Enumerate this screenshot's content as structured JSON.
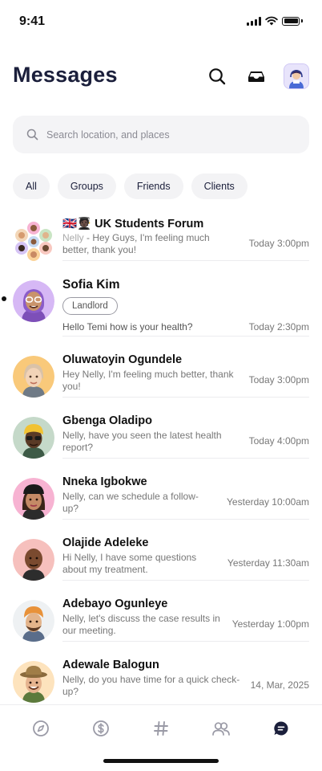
{
  "status_bar": {
    "time": "9:41"
  },
  "header": {
    "title": "Messages"
  },
  "search": {
    "placeholder": "Search location, and places"
  },
  "filters": [
    {
      "label": "All"
    },
    {
      "label": "Groups"
    },
    {
      "label": "Friends"
    },
    {
      "label": "Clients"
    }
  ],
  "conversations": [
    {
      "name": "🇬🇧🧑🏿‍🎓 UK Students Forum",
      "sender": "Nelly",
      "message": " - Hey Guys, I'm feeling much better, thank you!",
      "time": "Today 3:00pm",
      "avatar_bg": "#ffffff"
    },
    {
      "name": "Sofia Kim",
      "tag": "Landlord",
      "message": "Hello Temi how is your health?",
      "time": "Today 2:30pm",
      "unread": true,
      "avatar_bg": "#d6b8f5"
    },
    {
      "name": "Oluwatoyin Ogundele",
      "message": "Hey Nelly, I'm feeling much better, thank you!",
      "time": "Today 3:00pm",
      "avatar_bg": "#f9c97a"
    },
    {
      "name": "Gbenga Oladipo",
      "message": "Nelly, have you seen the latest health report?",
      "time": "Today 4:00pm",
      "avatar_bg": "#c5d9c9"
    },
    {
      "name": "Nneka Igbokwe",
      "message": "Nelly, can we schedule a follow-up?",
      "time": "Yesterday 10:00am",
      "avatar_bg": "#f7b3d2"
    },
    {
      "name": "Olajide Adeleke",
      "message": "Hi Nelly, I have some questions about my treatment.",
      "time": "Yesterday 11:30am",
      "avatar_bg": "#f6c0bd"
    },
    {
      "name": "Adebayo Ogunleye",
      "message": "Nelly, let's discuss the case results in our meeting.",
      "time": "Yesterday 1:00pm",
      "avatar_bg": "#eef1f3"
    },
    {
      "name": "Adewale Balogun",
      "message": "Nelly, do you have time for a quick check-up?",
      "time": "14, Mar, 2025",
      "avatar_bg": "#fde3bd"
    }
  ],
  "tab_bar": [
    {
      "icon": "compass-icon",
      "active": false
    },
    {
      "icon": "dollar-icon",
      "active": false
    },
    {
      "icon": "hashtag-icon",
      "active": false
    },
    {
      "icon": "people-icon",
      "active": false
    },
    {
      "icon": "chat-icon",
      "active": true
    }
  ],
  "colors": {
    "accent": "#1b1f3b",
    "inactive_icon": "#9a9aa6",
    "chip_bg": "#f3f3f5"
  }
}
